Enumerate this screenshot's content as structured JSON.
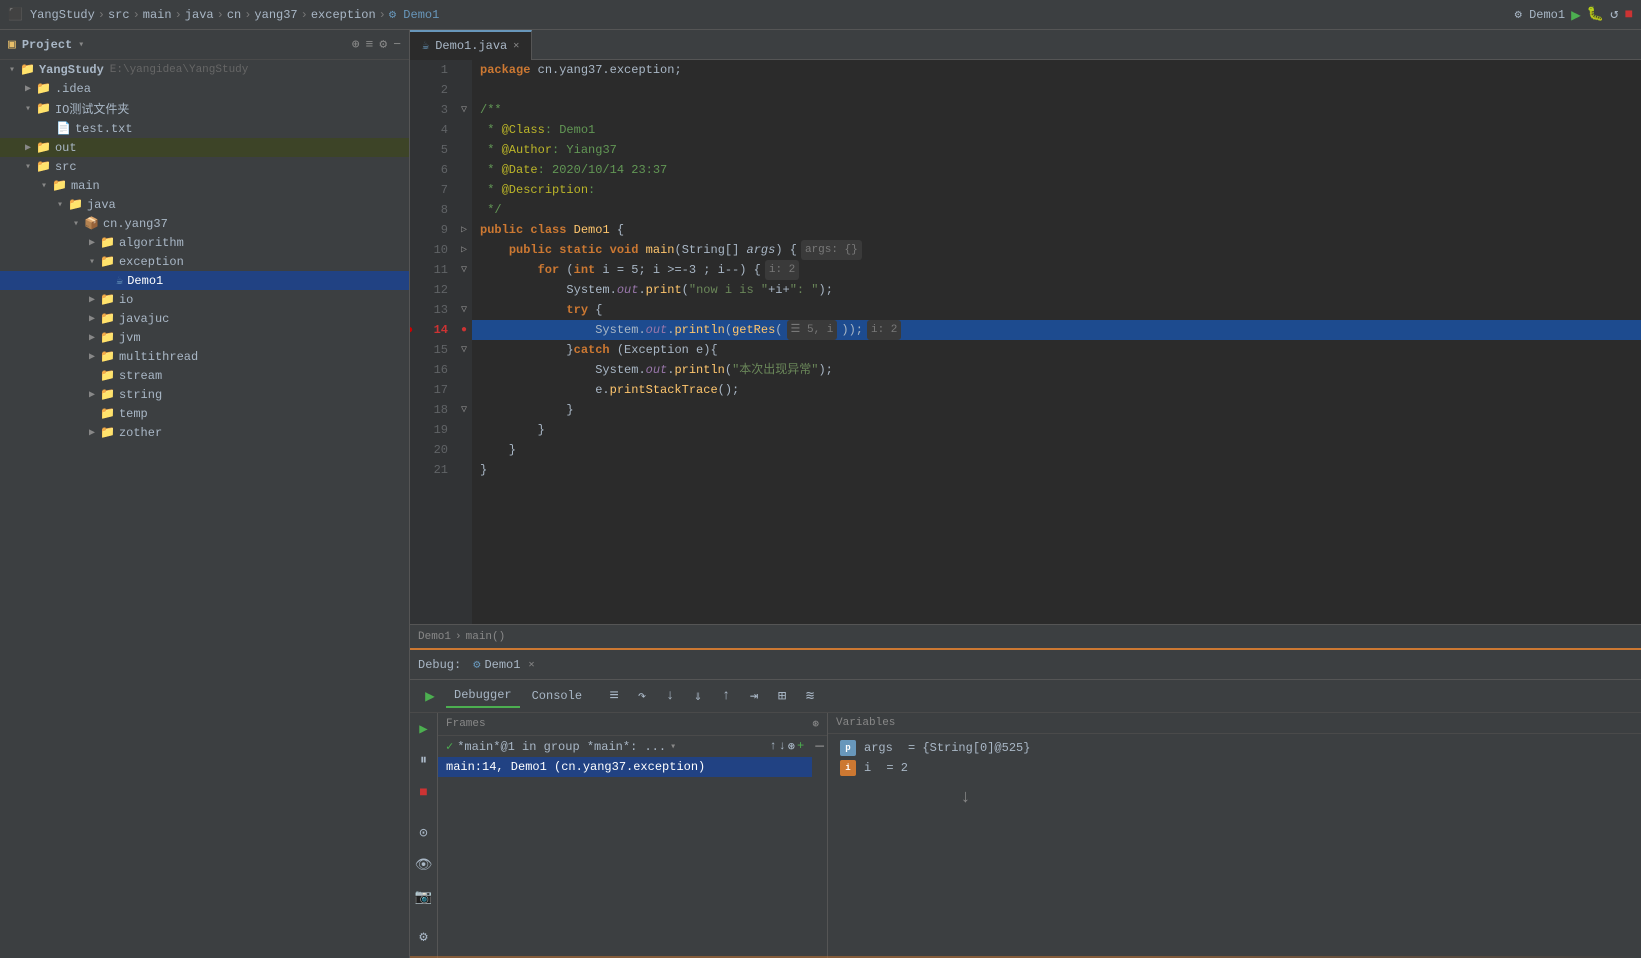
{
  "topbar": {
    "breadcrumb": [
      "YangStudy",
      "src",
      "main",
      "java",
      "cn",
      "yang37",
      "exception",
      "Demo1"
    ],
    "run_config": "Demo1",
    "icons": {
      "run": "▶",
      "debug": "🐛",
      "rerun": "↺",
      "stop": "■"
    }
  },
  "sidebar": {
    "title": "Project",
    "tree": [
      {
        "level": 0,
        "label": "YangStudy",
        "sublabel": "E:\\yangidea\\YangStudy",
        "type": "project",
        "expanded": true
      },
      {
        "level": 1,
        "label": ".idea",
        "type": "folder",
        "expanded": false
      },
      {
        "level": 1,
        "label": "IO测试文件夹",
        "type": "folder",
        "expanded": true
      },
      {
        "level": 2,
        "label": "test.txt",
        "type": "txt"
      },
      {
        "level": 1,
        "label": "out",
        "type": "folder",
        "expanded": false
      },
      {
        "level": 1,
        "label": "src",
        "type": "folder",
        "expanded": true
      },
      {
        "level": 2,
        "label": "main",
        "type": "folder",
        "expanded": true
      },
      {
        "level": 3,
        "label": "java",
        "type": "folder",
        "expanded": true
      },
      {
        "level": 4,
        "label": "cn.yang37",
        "type": "package",
        "expanded": true
      },
      {
        "level": 5,
        "label": "algorithm",
        "type": "folder",
        "expanded": false
      },
      {
        "level": 5,
        "label": "exception",
        "type": "folder",
        "expanded": true
      },
      {
        "level": 6,
        "label": "Demo1",
        "type": "java",
        "selected": true
      },
      {
        "level": 5,
        "label": "io",
        "type": "folder",
        "expanded": false
      },
      {
        "level": 5,
        "label": "javajuc",
        "type": "folder",
        "expanded": false
      },
      {
        "level": 5,
        "label": "jvm",
        "type": "folder",
        "expanded": false
      },
      {
        "level": 5,
        "label": "multithread",
        "type": "folder",
        "expanded": false
      },
      {
        "level": 5,
        "label": "stream",
        "type": "folder"
      },
      {
        "level": 5,
        "label": "string",
        "type": "folder",
        "expanded": false
      },
      {
        "level": 5,
        "label": "temp",
        "type": "folder"
      },
      {
        "level": 5,
        "label": "zother",
        "type": "folder",
        "expanded": false
      }
    ]
  },
  "editor": {
    "tab_label": "Demo1.java",
    "lines": [
      {
        "num": 1,
        "code": "package cn.yang37.exception;",
        "type": "normal"
      },
      {
        "num": 2,
        "code": "",
        "type": "normal"
      },
      {
        "num": 3,
        "code": "/**",
        "type": "normal",
        "fold": true
      },
      {
        "num": 4,
        "code": " * @Class: Demo1",
        "type": "comment"
      },
      {
        "num": 5,
        "code": " * @Author: Yiang37",
        "type": "comment"
      },
      {
        "num": 6,
        "code": " * @Date: 2020/10/14 23:37",
        "type": "comment"
      },
      {
        "num": 7,
        "code": " * @Description:",
        "type": "comment"
      },
      {
        "num": 8,
        "code": " */",
        "type": "comment"
      },
      {
        "num": 9,
        "code": "public class Demo1 {",
        "type": "normal",
        "fold": true,
        "runnable": true
      },
      {
        "num": 10,
        "code": "    public static void main(String[] args) {  args: {}",
        "type": "normal",
        "fold": true,
        "runnable": true
      },
      {
        "num": 11,
        "code": "        for (int i = 5; i >=-3 ; i--) {  i: 2",
        "type": "normal",
        "fold": true
      },
      {
        "num": 12,
        "code": "            System.out.print(\"now i is \"+i+\": \");",
        "type": "normal"
      },
      {
        "num": 13,
        "code": "            try {",
        "type": "normal",
        "fold": true
      },
      {
        "num": 14,
        "code": "                System.out.println(getRes(  5, i));  i: 2",
        "type": "highlighted",
        "breakpoint": true,
        "debug_arrow": true
      },
      {
        "num": 15,
        "code": "            }catch (Exception e){",
        "type": "normal",
        "fold": true
      },
      {
        "num": 16,
        "code": "                System.out.println(\"本次出现异常\");",
        "type": "normal"
      },
      {
        "num": 17,
        "code": "                e.printStackTrace();",
        "type": "normal"
      },
      {
        "num": 18,
        "code": "            }",
        "type": "normal",
        "fold": true
      },
      {
        "num": 19,
        "code": "        }",
        "type": "normal"
      },
      {
        "num": 20,
        "code": "    }",
        "type": "normal"
      },
      {
        "num": 21,
        "code": "}",
        "type": "normal"
      }
    ],
    "breadcrumb": "Demo1 › main()"
  },
  "debug": {
    "tab_label": "Demo1",
    "tabs": [
      "Debugger",
      "Console"
    ],
    "toolbar": {
      "rerun": "↺",
      "step_over": "↷",
      "step_into": "↓",
      "step_into_force": "↓↓",
      "step_out": "↑",
      "reset": "⟲",
      "resume": "▶",
      "table_view": "⊞",
      "settings": "≡"
    },
    "frames_header": "Frames",
    "vars_header": "Variables",
    "thread": "*main*@1 in group *main*: ...",
    "frame": "main:14, Demo1 (cn.yang37.exception)",
    "variables": [
      {
        "icon": "p",
        "name": "args",
        "value": "= {String[0]@525}"
      },
      {
        "icon": "i",
        "name": "i",
        "value": "= 2"
      }
    ]
  }
}
